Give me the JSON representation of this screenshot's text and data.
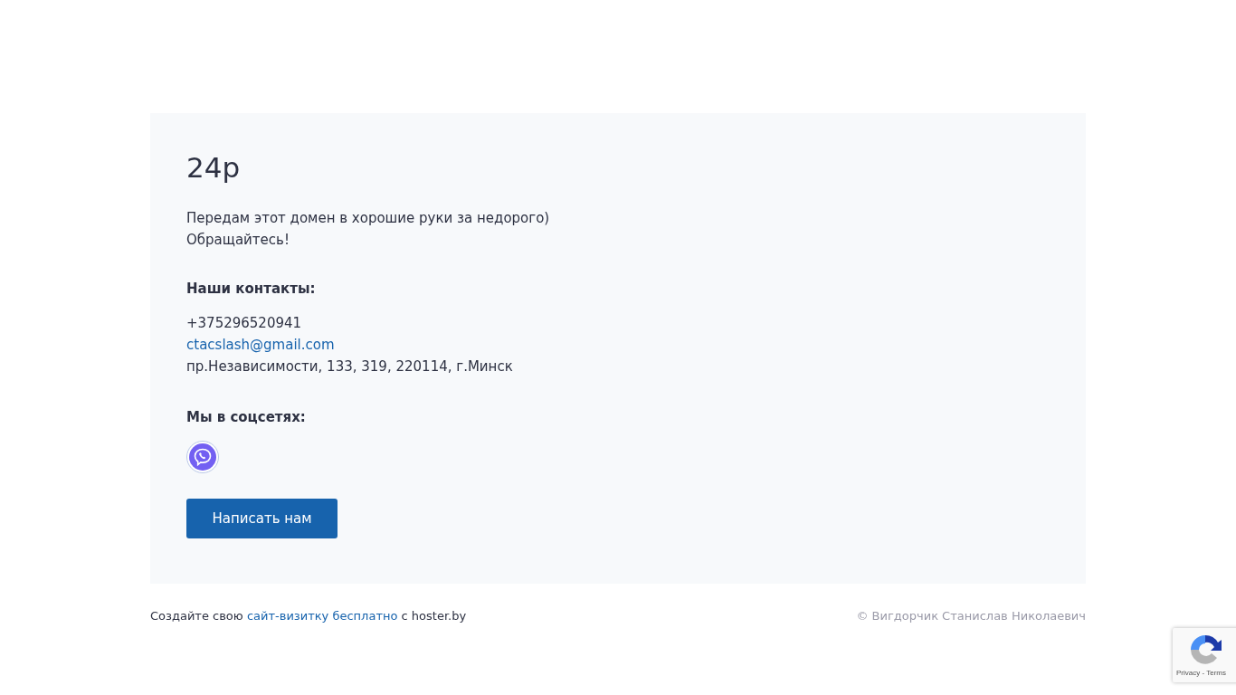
{
  "card": {
    "title": "24р",
    "description": [
      "Передам этот домен в хорошие руки за недорого)",
      "Обращайтесь!"
    ],
    "contacts_heading": "Наши контакты:",
    "contacts": [
      {
        "kind": "text",
        "text": "+375296520941"
      },
      {
        "kind": "link",
        "text": "ctacslash@gmail.com"
      },
      {
        "kind": "text",
        "text": "пр.Независимости, 133, 319, 220114, г.Минск"
      }
    ],
    "social_heading": "Мы в соцсетях:",
    "social": [
      {
        "kind": "viber"
      }
    ],
    "button": "Написать нам"
  },
  "footer": {
    "before": "Создайте свою ",
    "link": "сайт-визитку бесплатно",
    "after": " с hoster.by",
    "copyright": "© Вигдорчик Станислав Николаевич"
  },
  "recaptcha": {
    "links": "Privacy - Terms"
  }
}
